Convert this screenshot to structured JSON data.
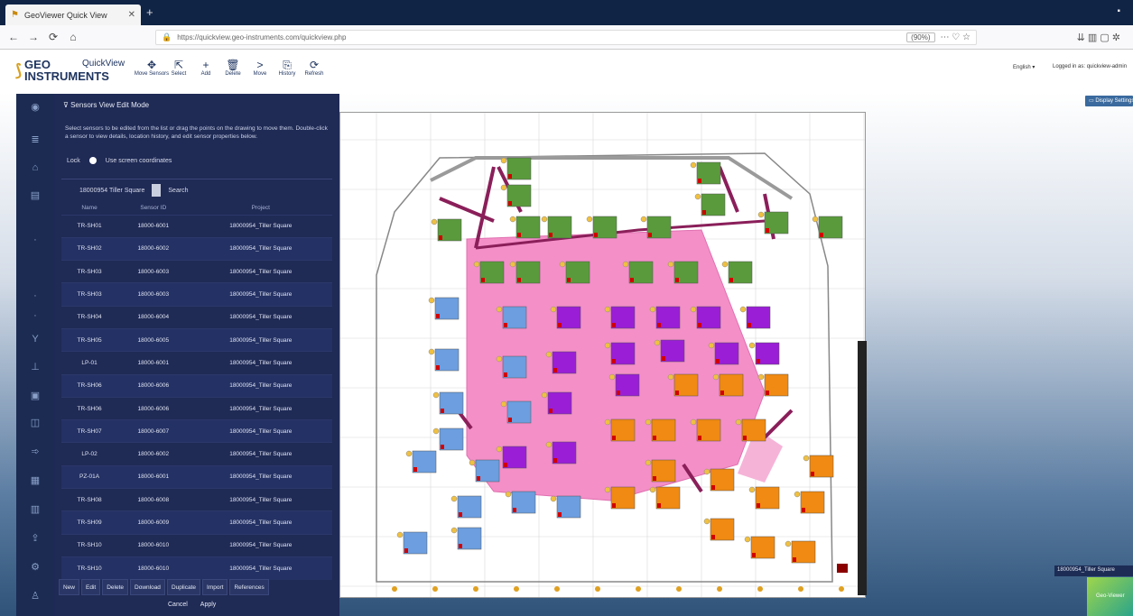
{
  "browser": {
    "tab_title": "GeoViewer Quick View",
    "tab_close": "✕",
    "new_tab": "+",
    "window_control": "▪",
    "url": "https://quickview.geo-instruments.com/quickview.php",
    "zoom": "(90%)",
    "nav_back": "←",
    "nav_forward": "→",
    "nav_reload": "⟳",
    "nav_home": "⌂",
    "url_extras": "⋯ ♡ ☆",
    "right_icons": "⇊ ▥ ▢ ✲"
  },
  "app": {
    "brand_line1": "GEO",
    "brand_line2": "INSTRUMENTS",
    "product": "QuickView",
    "toolbar": [
      {
        "label": "Move Sensors",
        "icon": "✥"
      },
      {
        "label": "Select",
        "icon": "⇱"
      },
      {
        "label": "Add",
        "icon": "+"
      },
      {
        "label": "Delete",
        "icon": "🗑"
      },
      {
        "label": "Move",
        "icon": ">"
      },
      {
        "label": "History",
        "icon": "⎘"
      },
      {
        "label": "Refresh",
        "icon": "⟳"
      }
    ],
    "language": "English ▾",
    "login_text": "Logged in as: quickview-admin",
    "display_button": "▭ Display Settings"
  },
  "panel": {
    "header": "Sensors View Edit Mode",
    "description": "Select sensors to be edited from the list or drag the points on the drawing to move them. Double-click a sensor to view details, location history, and edit sensor properties below.",
    "lock_label": "Lock",
    "coord_label": "Use screen coordinates",
    "project_name": "18000954 Tiller Square",
    "search_label": "Search",
    "columns": [
      "Name",
      "Sensor ID",
      "Project"
    ],
    "rows": [
      [
        "TR-SH01",
        "18000-6001",
        "18000954_Tiller Square"
      ],
      [
        "TR-SH02",
        "18000-6002",
        "18000954_Tiller Square"
      ],
      [
        "TR-SH03",
        "18000-6003",
        "18000954_Tiller Square"
      ],
      [
        "TR-SH03",
        "18000-6003",
        "18000954_Tiller Square"
      ],
      [
        "TR-SH04",
        "18000-6004",
        "18000954_Tiller Square"
      ],
      [
        "TR-SH05",
        "18000-6005",
        "18000954_Tiller Square"
      ],
      [
        "LP-01",
        "18000-6001",
        "18000954_Tiller Square"
      ],
      [
        "TR-SH06",
        "18000-6006",
        "18000954_Tiller Square"
      ],
      [
        "TR-SH06",
        "18000-6006",
        "18000954_Tiller Square"
      ],
      [
        "TR-SH07",
        "18000-6007",
        "18000954_Tiller Square"
      ],
      [
        "LP-02",
        "18000-6002",
        "18000954_Tiller Square"
      ],
      [
        "PZ-01A",
        "18000-6001",
        "18000954_Tiller Square"
      ],
      [
        "TR-SH08",
        "18000-6008",
        "18000954_Tiller Square"
      ],
      [
        "TR-SH09",
        "18000-6009",
        "18000954_Tiller Square"
      ],
      [
        "TR-SH10",
        "18000-6010",
        "18000954_Tiller Square"
      ],
      [
        "TR-SH10",
        "18000-6010",
        "18000954_Tiller Square"
      ]
    ],
    "buttons": [
      "New",
      "Edit",
      "Delete",
      "Download",
      "Duplicate",
      "Import",
      "References"
    ],
    "cancel": "Cancel",
    "apply": "Apply"
  },
  "status": {
    "project_tag": "18000954_Tiller Square",
    "badge": "Geo-Viewer"
  },
  "sensor_colors": {
    "green": "#5a9a3c",
    "blue": "#6c9ee0",
    "purple": "#9a1ed6",
    "orange": "#f08a12",
    "pink_zone": "#f48fc8",
    "beam": "#8a1f5a"
  }
}
